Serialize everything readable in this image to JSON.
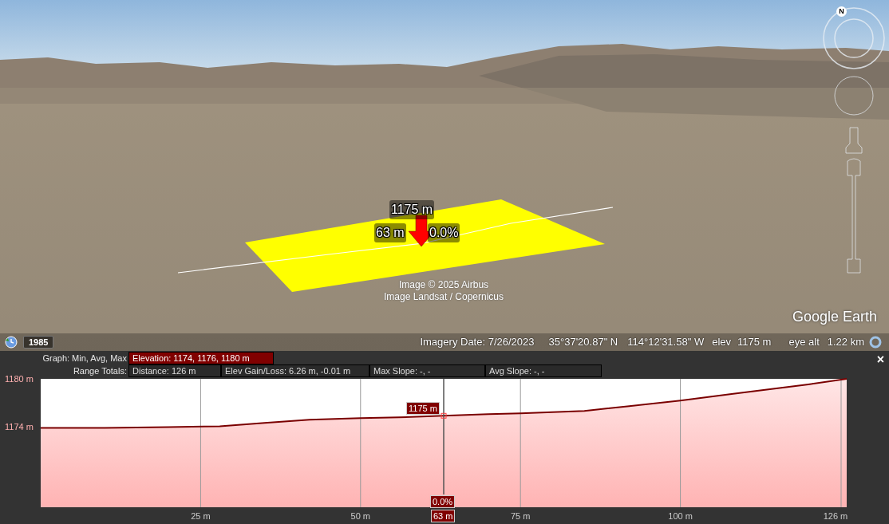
{
  "map": {
    "compass_label": "N",
    "measure_labels": {
      "elevation": "1175 m",
      "distance": "63 m",
      "slope": "0.0%"
    },
    "attribution": [
      "Image © 2025 Airbus",
      "Image Landsat / Copernicus"
    ],
    "logo": "Google Earth",
    "historical_imagery": {
      "year": "1985"
    },
    "status_bar": {
      "imagery_date": "Imagery Date: 7/26/2023",
      "latitude": "35°37'20.87\" N",
      "longitude": "114°12'31.58\" W",
      "elev_label": "elev",
      "elev_value": "1175 m",
      "eye_alt_label": "eye alt",
      "eye_alt_value": "1.22 km"
    }
  },
  "profile": {
    "close": "×",
    "graph_label": "Graph: Min, Avg, Max",
    "graph_options": [
      {
        "label": "Elevation: 1174, 1176, 1180 m",
        "selected": true
      }
    ],
    "range_label": "Range Totals:",
    "range_totals": [
      "Distance: 126 m",
      "Elev Gain/Loss: 6.26 m, -0.01 m",
      "Max Slope: -, -",
      "Avg Slope: -, -"
    ],
    "cursor": {
      "elevation": "1175 m",
      "slope": "0.0%",
      "distance": "63 m"
    },
    "chart_data": {
      "type": "area",
      "grid": true,
      "ref_lines": [
        {
          "axis": "x",
          "value": 63
        }
      ],
      "x": [
        0,
        10,
        20,
        28,
        35,
        42,
        50,
        56,
        63,
        70,
        75,
        85,
        92,
        100,
        108,
        115,
        120,
        126
      ],
      "series": [
        {
          "color": "#7a0000",
          "values": [
            1173.9,
            1173.9,
            1174.0,
            1174.1,
            1174.5,
            1174.9,
            1175.1,
            1175.2,
            1175.4,
            1175.6,
            1175.7,
            1176.0,
            1176.6,
            1177.3,
            1178.1,
            1178.8,
            1179.3,
            1180.0
          ]
        }
      ],
      "xlim": [
        0,
        126
      ],
      "ylim": [
        1164,
        1180
      ],
      "xticks": [
        {
          "value": 25,
          "label": "25 m"
        },
        {
          "value": 50,
          "label": "50 m"
        },
        {
          "value": 75,
          "label": "75 m"
        },
        {
          "value": 100,
          "label": "100 m"
        },
        {
          "value": 126,
          "label": "126 m"
        }
      ],
      "yticks": [
        {
          "value": 1174,
          "label": "1174 m"
        },
        {
          "value": 1180,
          "label": "1180 m"
        }
      ]
    }
  }
}
